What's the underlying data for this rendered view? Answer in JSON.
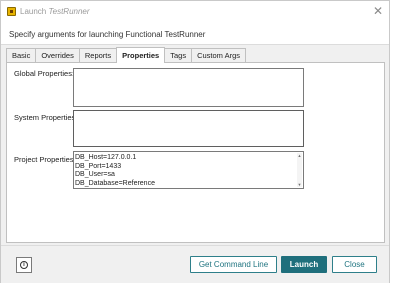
{
  "window": {
    "title_prefix": "Launch ",
    "title_app": "TestRunner",
    "close_glyph": "✕"
  },
  "header": {
    "text": "Specify arguments for launching Functional TestRunner"
  },
  "tabs": [
    {
      "label": "Basic"
    },
    {
      "label": "Overrides"
    },
    {
      "label": "Reports"
    },
    {
      "label": "Properties"
    },
    {
      "label": "Tags"
    },
    {
      "label": "Custom Args"
    }
  ],
  "active_tab": "Properties",
  "properties": {
    "global_label": "Global Properties:",
    "global_value": "",
    "system_label": "System Properties:",
    "system_value": "",
    "project_label": "Project Properties:",
    "project_lines": [
      "DB_Host=127.0.0.1",
      "DB_Port=1433",
      "DB_User=sa",
      "DB_Database=Reference"
    ]
  },
  "footer": {
    "info_glyph": "i",
    "get_command_line_label": "Get Command Line",
    "launch_label": "Launch",
    "close_label": "Close"
  },
  "colors": {
    "accent": "#1f6f7c",
    "app_icon": "#e8b400"
  },
  "icons": [
    "app-icon",
    "close-icon",
    "info-icon",
    "scroll-up-icon",
    "scroll-down-icon"
  ]
}
